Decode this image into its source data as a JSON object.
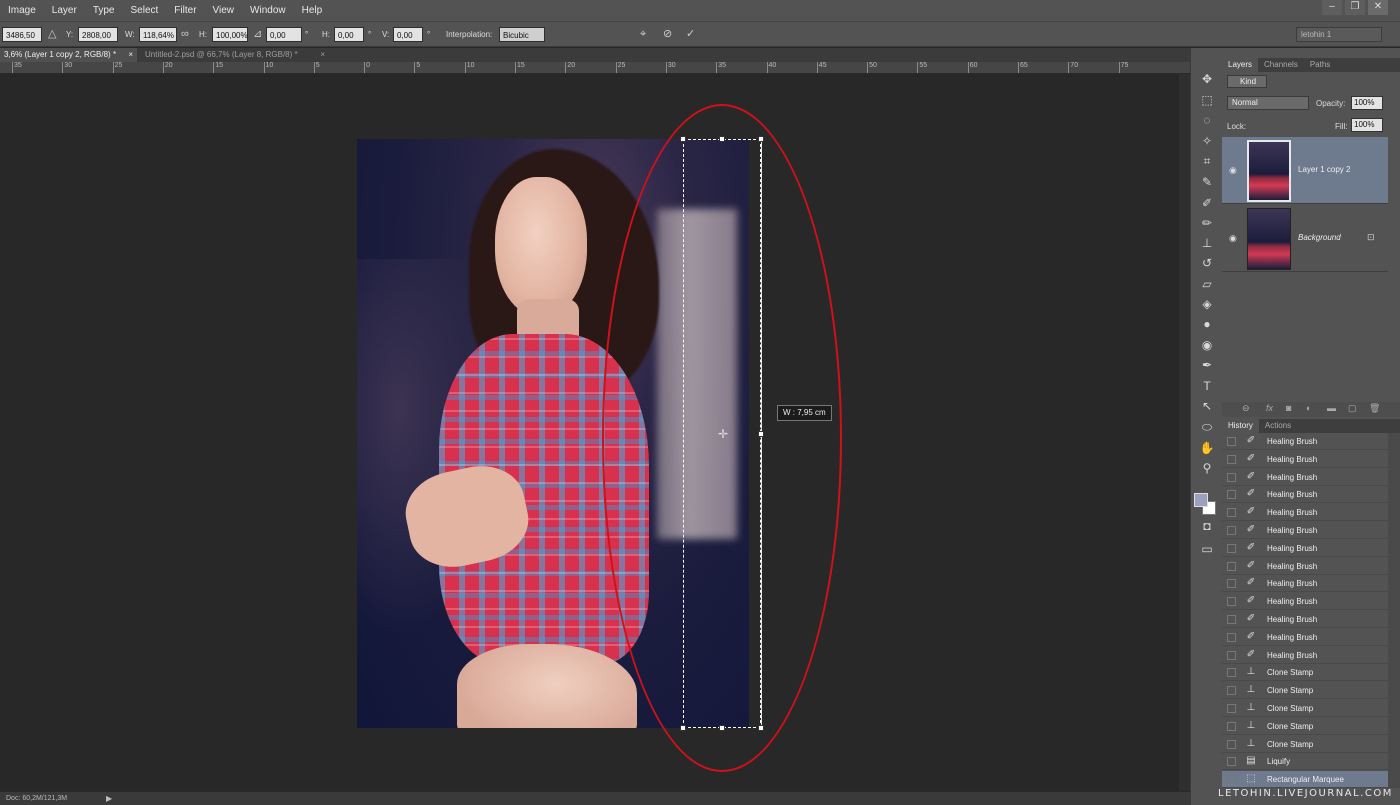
{
  "menu": [
    "Image",
    "Layer",
    "Type",
    "Select",
    "Filter",
    "View",
    "Window",
    "Help"
  ],
  "window_controls": [
    "–",
    "❐",
    "✕"
  ],
  "options": {
    "x_value": "3486,50 p",
    "y_label": "Y:",
    "y_value": "2808,00 p",
    "w_label": "W:",
    "w_value": "118,64%",
    "h_label": "H:",
    "h_value": "100,00%",
    "angle_value": "0,00",
    "deg1": "°",
    "hskew_label": "H:",
    "hskew_value": "0,00",
    "deg2": "°",
    "vskew_label": "V:",
    "vskew_value": "0,00",
    "deg3": "°",
    "interp_label": "Interpolation:",
    "interp_value": "Bicubic",
    "workspace": "letohin 1"
  },
  "tabs": [
    {
      "label": "3,6% (Layer 1 copy 2, RGB/8) *"
    },
    {
      "label": "Untitled-2.psd @ 66,7% (Layer 8, RGB/8) *"
    }
  ],
  "ruler_labels": [
    "35",
    "30",
    "25",
    "20",
    "15",
    "10",
    "5",
    "0",
    "5",
    "10",
    "15",
    "20",
    "25",
    "30",
    "35",
    "40",
    "45",
    "50",
    "55",
    "60",
    "65",
    "70",
    "75"
  ],
  "canvas": {
    "w_readout": "W : 7,95 cm"
  },
  "status": {
    "doc": "Doc: 60,2M/121,3M"
  },
  "layers_panel": {
    "tabs": [
      "Layers",
      "Channels",
      "Paths"
    ],
    "kind": "Kind",
    "blend_mode": "Normal",
    "opacity_label": "Opacity:",
    "opacity": "100%",
    "lock_label": "Lock:",
    "fill_label": "Fill:",
    "fill": "100%",
    "layers": [
      {
        "name": "Layer 1 copy 2"
      },
      {
        "name": "Background"
      }
    ]
  },
  "history_panel": {
    "tabs": [
      "History",
      "Actions"
    ],
    "items": [
      {
        "label": "Healing Brush",
        "icon": "healing-brush-icon"
      },
      {
        "label": "Healing Brush",
        "icon": "healing-brush-icon"
      },
      {
        "label": "Healing Brush",
        "icon": "healing-brush-icon"
      },
      {
        "label": "Healing Brush",
        "icon": "healing-brush-icon"
      },
      {
        "label": "Healing Brush",
        "icon": "healing-brush-icon"
      },
      {
        "label": "Healing Brush",
        "icon": "healing-brush-icon"
      },
      {
        "label": "Healing Brush",
        "icon": "healing-brush-icon"
      },
      {
        "label": "Healing Brush",
        "icon": "healing-brush-icon"
      },
      {
        "label": "Healing Brush",
        "icon": "healing-brush-icon"
      },
      {
        "label": "Healing Brush",
        "icon": "healing-brush-icon"
      },
      {
        "label": "Healing Brush",
        "icon": "healing-brush-icon"
      },
      {
        "label": "Healing Brush",
        "icon": "healing-brush-icon"
      },
      {
        "label": "Healing Brush",
        "icon": "healing-brush-icon"
      },
      {
        "label": "Clone Stamp",
        "icon": "clone-stamp-icon"
      },
      {
        "label": "Clone Stamp",
        "icon": "clone-stamp-icon"
      },
      {
        "label": "Clone Stamp",
        "icon": "clone-stamp-icon"
      },
      {
        "label": "Clone Stamp",
        "icon": "clone-stamp-icon"
      },
      {
        "label": "Clone Stamp",
        "icon": "clone-stamp-icon"
      },
      {
        "label": "Liquify",
        "icon": "liquify-icon"
      },
      {
        "label": "Rectangular Marquee",
        "icon": "marquee-icon"
      }
    ]
  },
  "watermark": "LETOHIN.LIVEJOURNAL.COM",
  "colors": {
    "selected_row": "#6e7a8d",
    "annotation_ellipse": "#d0111a",
    "foreground": "#9aa0be",
    "background": "#ffffff"
  }
}
